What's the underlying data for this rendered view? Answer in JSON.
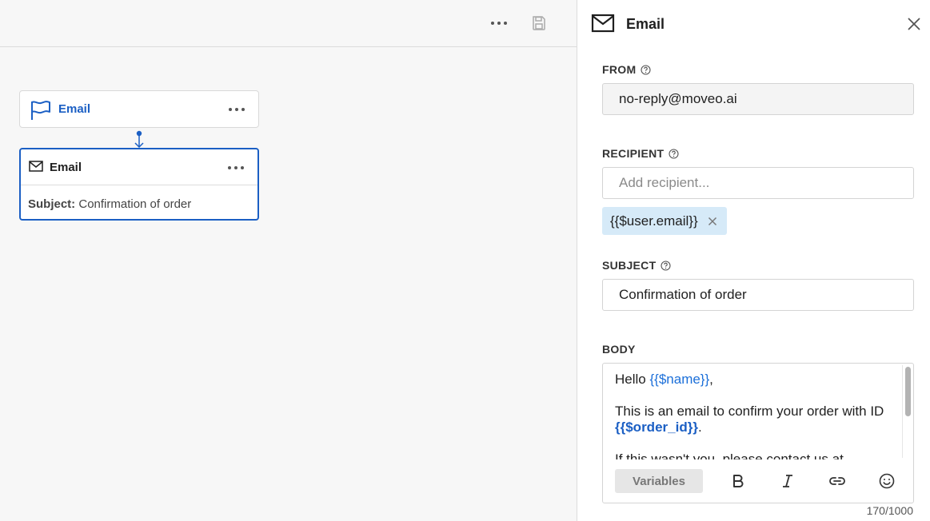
{
  "canvas": {
    "toolbar": {
      "more_icon": "ellipsis-icon",
      "save_icon": "save-icon"
    },
    "nodes": [
      {
        "title": "Email",
        "icon": "flag-icon"
      },
      {
        "title": "Email",
        "icon": "mail-icon",
        "subject_label": "Subject:",
        "subject_value": "Confirmation of order"
      }
    ]
  },
  "panel": {
    "title": "Email",
    "from": {
      "label": "FROM",
      "value": "no-reply@moveo.ai"
    },
    "recipient": {
      "label": "RECIPIENT",
      "placeholder": "Add recipient...",
      "chips": [
        "{{$user.email}}"
      ]
    },
    "subject": {
      "label": "SUBJECT",
      "value": "Confirmation of order"
    },
    "body": {
      "label": "BODY",
      "line1_prefix": "Hello ",
      "line1_var": "{{$name}}",
      "line1_suffix": ",",
      "line2": "This is an email to confirm your order with ID ",
      "line2_var": "{{$order_id}}",
      "line2_suffix": ".",
      "line3": "If this wasn't you, please contact us at",
      "variables_button": "Variables",
      "counter": "170/1000"
    },
    "colors": {
      "accent": "#1b5fc4",
      "chip_bg": "#d6eaf8"
    }
  }
}
